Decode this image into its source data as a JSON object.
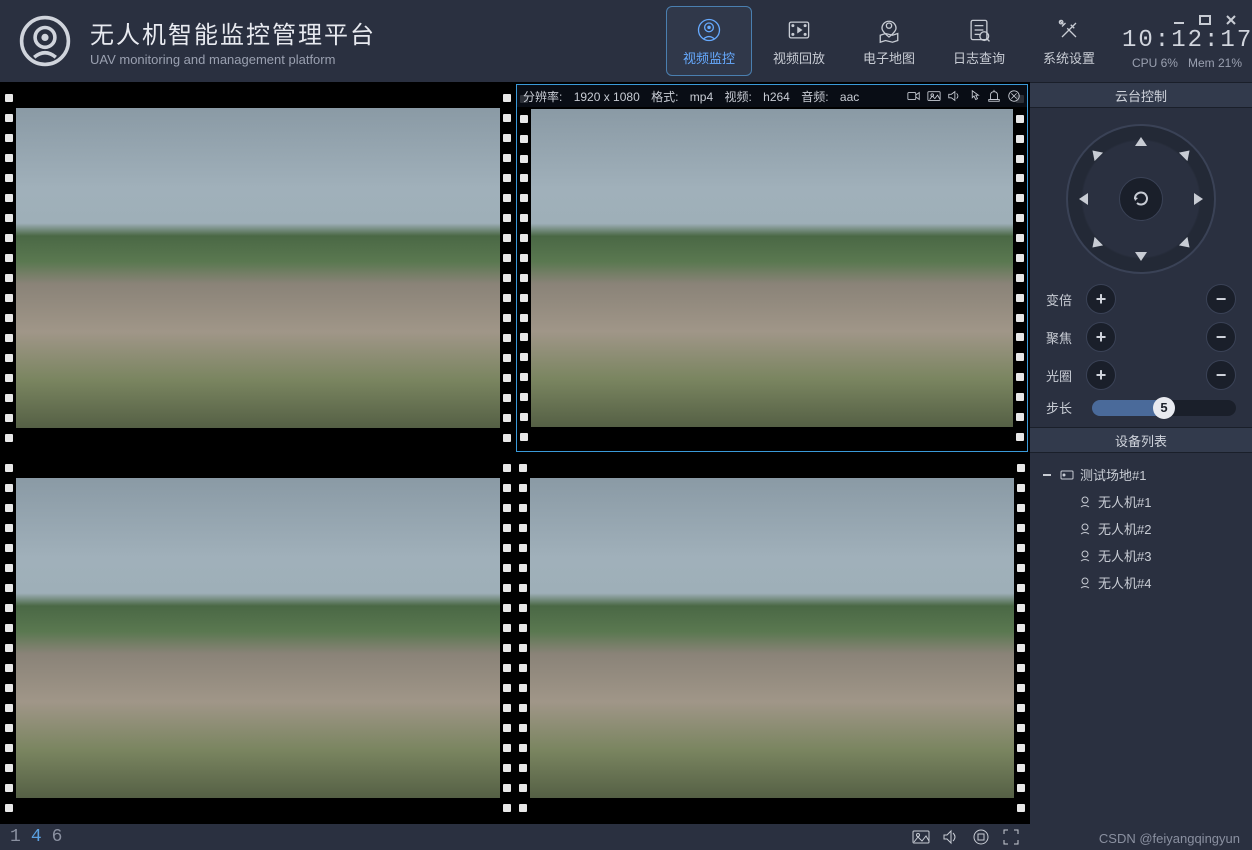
{
  "header": {
    "title_cn": "无人机智能监控管理平台",
    "title_en": "UAV monitoring and management platform",
    "clock": "10:12:17",
    "cpu_label": "CPU 6%",
    "mem_label": "Mem 21%"
  },
  "nav": [
    {
      "label": "视频监控",
      "icon": "camera",
      "active": true
    },
    {
      "label": "视频回放",
      "icon": "playback",
      "active": false
    },
    {
      "label": "电子地图",
      "icon": "map",
      "active": false
    },
    {
      "label": "日志查询",
      "icon": "log",
      "active": false
    },
    {
      "label": "系统设置",
      "icon": "settings",
      "active": false
    }
  ],
  "video_info": {
    "resolution_label": "分辨率:",
    "resolution": "1920 x 1080",
    "format_label": "格式:",
    "format": "mp4",
    "video_label": "视频:",
    "video": "h264",
    "audio_label": "音频:",
    "audio": "aac"
  },
  "ptz": {
    "panel_title": "云台控制",
    "zoom_label": "变倍",
    "focus_label": "聚焦",
    "iris_label": "光圈",
    "step_label": "步长",
    "step_value": "5"
  },
  "devices": {
    "panel_title": "设备列表",
    "group": "测试场地#1",
    "items": [
      "无人机#1",
      "无人机#2",
      "无人机#3",
      "无人机#4"
    ]
  },
  "layout_options": [
    "1",
    "4",
    "6"
  ],
  "layout_active": "4",
  "watermark": "CSDN @feiyangqingyun"
}
